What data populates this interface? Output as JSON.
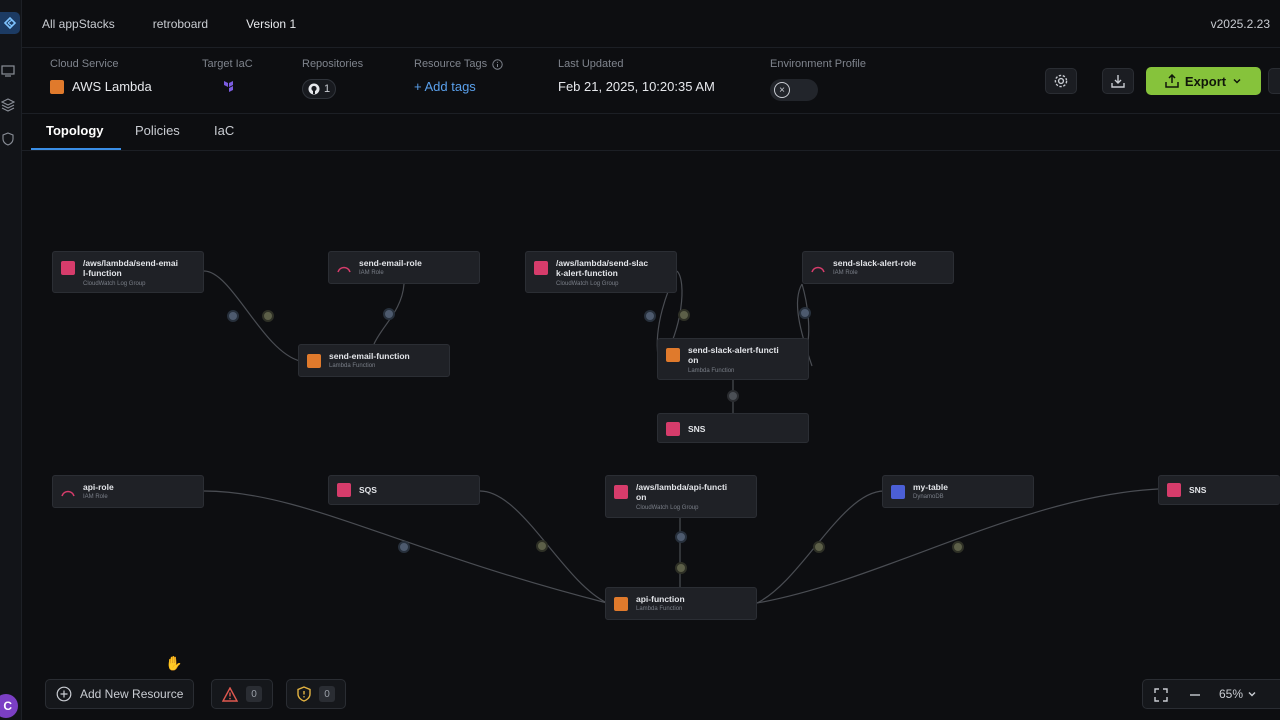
{
  "breadcrumbs": [
    "All appStacks",
    "retroboard",
    "Version 1"
  ],
  "app_version": "v2025.2.23",
  "info": {
    "cloud_service": {
      "label": "Cloud Service",
      "value": "AWS Lambda"
    },
    "target_iac": {
      "label": "Target IaC"
    },
    "repositories": {
      "label": "Repositories",
      "count": "1"
    },
    "resource_tags": {
      "label": "Resource Tags",
      "add_label": "+ Add tags"
    },
    "last_updated": {
      "label": "Last Updated",
      "value": "Feb 21, 2025, 10:20:35 AM"
    },
    "environment_profile": {
      "label": "Environment Profile"
    }
  },
  "toolbar": {
    "export_label": "Export"
  },
  "tabs": [
    {
      "label": "Topology",
      "active": true
    },
    {
      "label": "Policies",
      "active": false
    },
    {
      "label": "IaC",
      "active": false
    }
  ],
  "nodes": [
    {
      "title": "/aws/lambda/send-emai l-function",
      "subtitle": "CloudWatch Log Group",
      "icon": "cloudwatch-icon"
    },
    {
      "title": "send-email-role",
      "subtitle": "IAM Role",
      "icon": "iam-role-icon"
    },
    {
      "title": "/aws/lambda/send-slac k-alert-function",
      "subtitle": "CloudWatch Log Group",
      "icon": "cloudwatch-icon"
    },
    {
      "title": "send-slack-alert-role",
      "subtitle": "IAM Role",
      "icon": "iam-role-icon"
    },
    {
      "title": "send-email-function",
      "subtitle": "Lambda Function",
      "icon": "lambda-icon"
    },
    {
      "title": "send-slack-alert-functi on",
      "subtitle": "Lambda Function",
      "icon": "lambda-icon"
    },
    {
      "title": "SNS",
      "subtitle": "",
      "icon": "sns-icon"
    },
    {
      "title": "api-role",
      "subtitle": "IAM Role",
      "icon": "iam-role-icon"
    },
    {
      "title": "SQS",
      "subtitle": "",
      "icon": "sqs-icon"
    },
    {
      "title": "/aws/lambda/api-functi on",
      "subtitle": "CloudWatch Log Group",
      "icon": "cloudwatch-icon"
    },
    {
      "title": "my-table",
      "subtitle": "DynamoDB",
      "icon": "dynamodb-icon"
    },
    {
      "title": "SNS",
      "subtitle": "",
      "icon": "sns-icon"
    },
    {
      "title": "api-function",
      "subtitle": "Lambda Function",
      "icon": "lambda-icon"
    }
  ],
  "bottom": {
    "add_resource_label": "Add New Resource",
    "warnings_count": "0",
    "policy_count": "0",
    "zoom": "65%"
  },
  "user": {
    "avatar_initial": "C"
  },
  "colors": {
    "accent": "#3a8ee6",
    "export": "#86c33b",
    "lambda": "#e07a2c",
    "sns": "#d63c6b",
    "dynamodb": "#4b5fd6"
  }
}
